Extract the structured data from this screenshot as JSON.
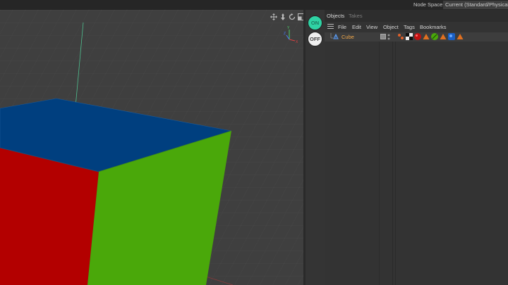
{
  "topbar": {
    "node_space_label": "Node Space:",
    "node_space_value": "Current (Standard/Physical)"
  },
  "viewport": {
    "nav_icons": [
      "move-icon",
      "zoom-icon",
      "rotate-icon",
      "maximize-icon"
    ],
    "axis_labels": {
      "y": "Y",
      "x": "X",
      "z": "Z"
    },
    "cube_face_colors": {
      "top": "#003f7f",
      "left": "#b30000",
      "right": "#4aa80a"
    }
  },
  "layers": {
    "on_label": "ON",
    "off_label": "OFF"
  },
  "object_manager": {
    "tabs": [
      {
        "label": "Objects"
      },
      {
        "label": "Takes"
      }
    ],
    "menu": [
      {
        "label": "File"
      },
      {
        "label": "Edit"
      },
      {
        "label": "View"
      },
      {
        "label": "Object"
      },
      {
        "label": "Tags"
      },
      {
        "label": "Bookmarks"
      }
    ],
    "objects": [
      {
        "name": "Cube",
        "name_color": "#f0a74a"
      }
    ],
    "tag_icons": [
      "phong-tag-icon",
      "checker-material-icon",
      "red-material-icon",
      "warning-tag-icon",
      "green-material-icon",
      "warning-tag-icon",
      "blue-material-icon",
      "warning-tag-icon"
    ]
  }
}
